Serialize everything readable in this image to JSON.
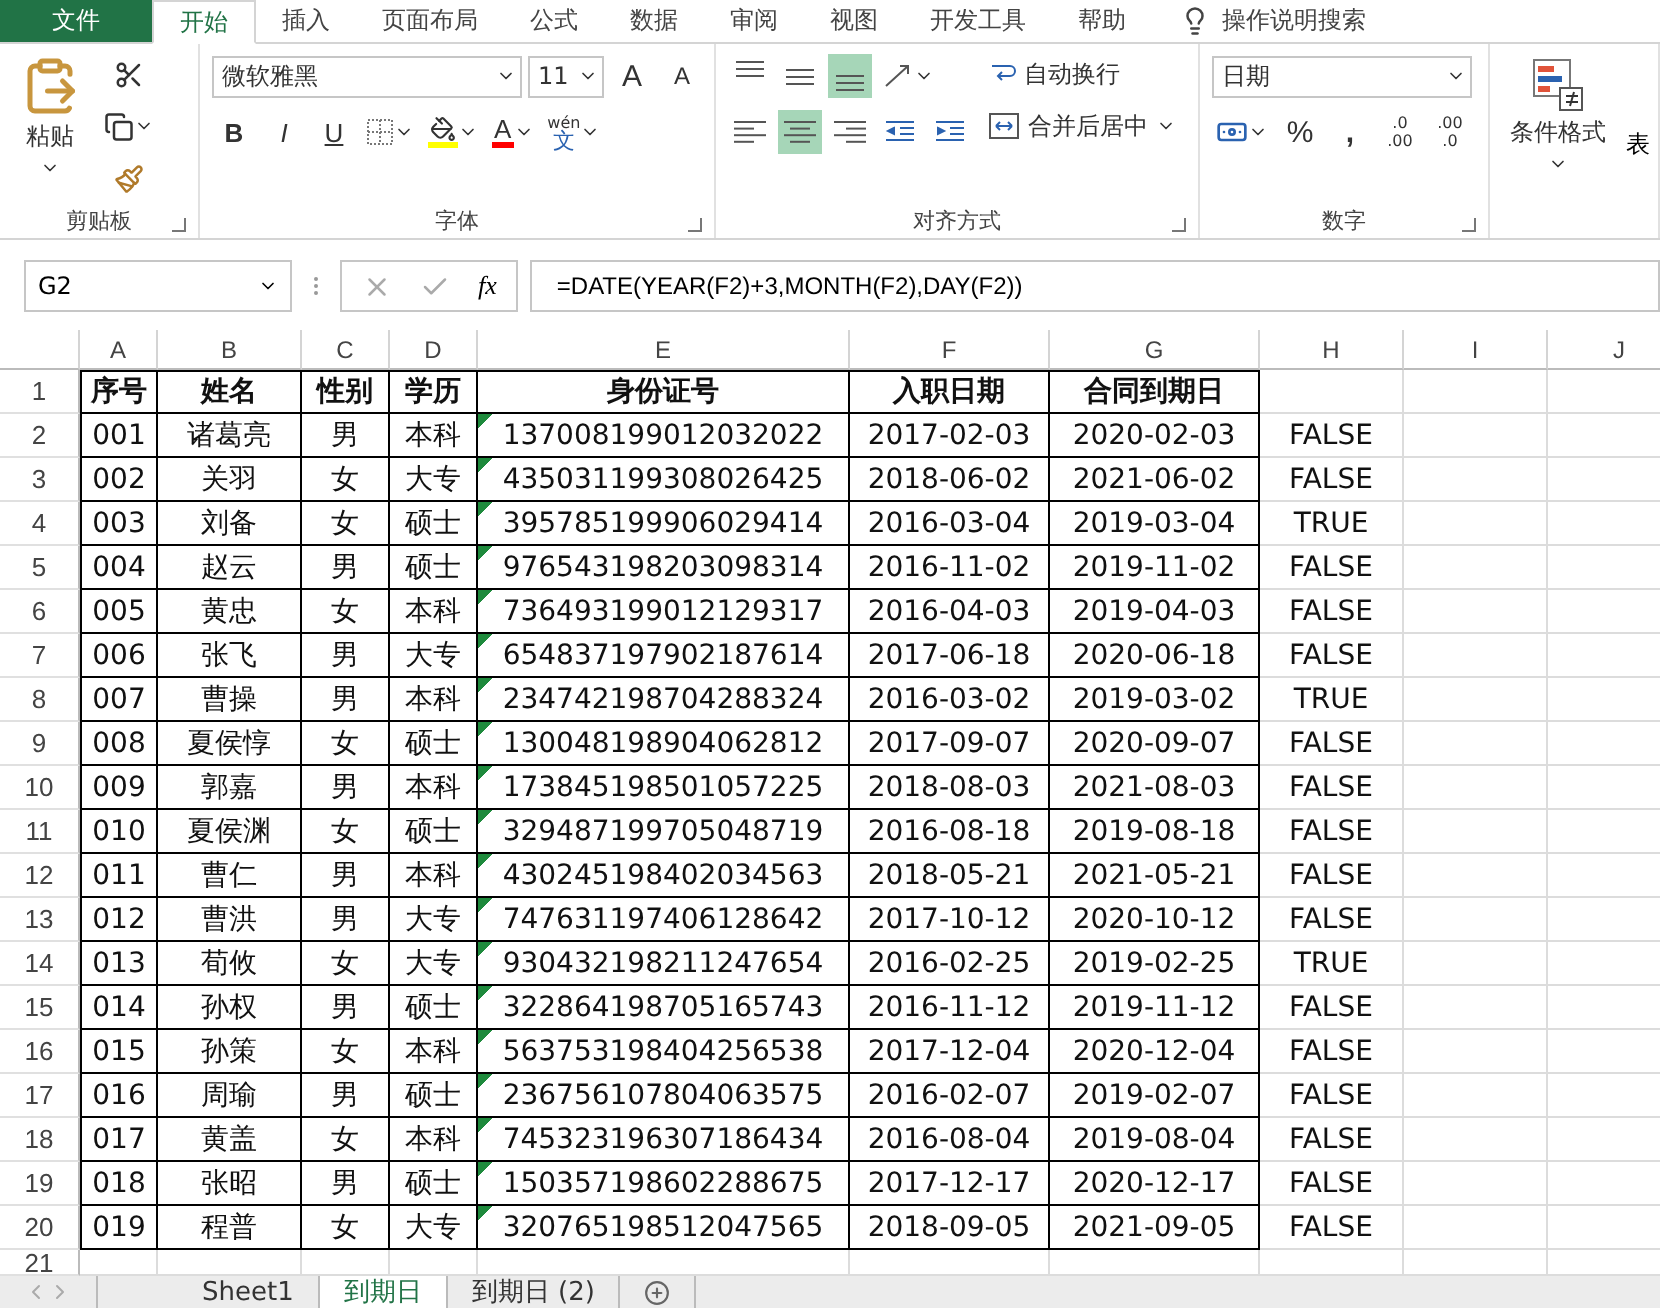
{
  "ribbon_tabs": [
    {
      "label": "文件",
      "kind": "file",
      "selected": false
    },
    {
      "label": "开始",
      "kind": "tab",
      "selected": true
    },
    {
      "label": "插入",
      "kind": "tab",
      "selected": false
    },
    {
      "label": "页面布局",
      "kind": "tab",
      "selected": false
    },
    {
      "label": "公式",
      "kind": "tab",
      "selected": false
    },
    {
      "label": "数据",
      "kind": "tab",
      "selected": false
    },
    {
      "label": "审阅",
      "kind": "tab",
      "selected": false
    },
    {
      "label": "视图",
      "kind": "tab",
      "selected": false
    },
    {
      "label": "开发工具",
      "kind": "tab",
      "selected": false
    },
    {
      "label": "帮助",
      "kind": "tab",
      "selected": false
    }
  ],
  "tell_me": "操作说明搜索",
  "clipboard": {
    "paste": "粘贴",
    "group": "剪贴板"
  },
  "font": {
    "name": "微软雅黑",
    "size": "11",
    "grow": "A",
    "shrink": "A",
    "bold": "B",
    "italic": "I",
    "underline": "U",
    "color_letter": "A",
    "phonetic_top": "wén",
    "phonetic_bottom": "文",
    "group": "字体"
  },
  "alignment": {
    "vertical": [
      {
        "kind": "top",
        "selected": false
      },
      {
        "kind": "middle",
        "selected": false
      },
      {
        "kind": "bottom",
        "selected": true
      }
    ],
    "horizontal": [
      {
        "kind": "left",
        "selected": false
      },
      {
        "kind": "center",
        "selected": true
      },
      {
        "kind": "right",
        "selected": false
      }
    ],
    "wrap": "自动换行",
    "merge": "合并后居中",
    "group": "对齐方式"
  },
  "number": {
    "format": "日期",
    "percent": "%",
    "comma": ",",
    "inc_top": ".0",
    "inc_bottom": ".00",
    "dec_top": ".00",
    "dec_bottom": ".0",
    "group": "数字"
  },
  "styles": {
    "conditional": "条件格式",
    "cut_off": "表"
  },
  "name_box": "G2",
  "fx": "fx",
  "formula": "=DATE(YEAR(F2)+3,MONTH(F2),DAY(F2))",
  "columns": [
    "A",
    "B",
    "C",
    "D",
    "E",
    "F",
    "G",
    "H",
    "I",
    "J"
  ],
  "header_row": [
    "序号",
    "姓名",
    "性别",
    "学历",
    "身份证号",
    "入职日期",
    "合同到期日"
  ],
  "rows": [
    {
      "cells": [
        "001",
        "诸葛亮",
        "男",
        "本科",
        "137008199012032022",
        "2017-02-03",
        "2020-02-03"
      ],
      "h": "FALSE"
    },
    {
      "cells": [
        "002",
        "关羽",
        "女",
        "大专",
        "435031199308026425",
        "2018-06-02",
        "2021-06-02"
      ],
      "h": "FALSE"
    },
    {
      "cells": [
        "003",
        "刘备",
        "女",
        "硕士",
        "395785199906029414",
        "2016-03-04",
        "2019-03-04"
      ],
      "h": "TRUE"
    },
    {
      "cells": [
        "004",
        "赵云",
        "男",
        "硕士",
        "976543198203098314",
        "2016-11-02",
        "2019-11-02"
      ],
      "h": "FALSE"
    },
    {
      "cells": [
        "005",
        "黄忠",
        "女",
        "本科",
        "736493199012129317",
        "2016-04-03",
        "2019-04-03"
      ],
      "h": "FALSE"
    },
    {
      "cells": [
        "006",
        "张飞",
        "男",
        "大专",
        "654837197902187614",
        "2017-06-18",
        "2020-06-18"
      ],
      "h": "FALSE"
    },
    {
      "cells": [
        "007",
        "曹操",
        "男",
        "本科",
        "234742198704288324",
        "2016-03-02",
        "2019-03-02"
      ],
      "h": "TRUE"
    },
    {
      "cells": [
        "008",
        "夏侯惇",
        "女",
        "硕士",
        "130048198904062812",
        "2017-09-07",
        "2020-09-07"
      ],
      "h": "FALSE"
    },
    {
      "cells": [
        "009",
        "郭嘉",
        "男",
        "本科",
        "173845198501057225",
        "2018-08-03",
        "2021-08-03"
      ],
      "h": "FALSE"
    },
    {
      "cells": [
        "010",
        "夏侯渊",
        "女",
        "硕士",
        "329487199705048719",
        "2016-08-18",
        "2019-08-18"
      ],
      "h": "FALSE"
    },
    {
      "cells": [
        "011",
        "曹仁",
        "男",
        "本科",
        "430245198402034563",
        "2018-05-21",
        "2021-05-21"
      ],
      "h": "FALSE"
    },
    {
      "cells": [
        "012",
        "曹洪",
        "男",
        "大专",
        "747631197406128642",
        "2017-10-12",
        "2020-10-12"
      ],
      "h": "FALSE"
    },
    {
      "cells": [
        "013",
        "荀攸",
        "女",
        "大专",
        "930432198211247654",
        "2016-02-25",
        "2019-02-25"
      ],
      "h": "TRUE"
    },
    {
      "cells": [
        "014",
        "孙权",
        "男",
        "硕士",
        "322864198705165743",
        "2016-11-12",
        "2019-11-12"
      ],
      "h": "FALSE"
    },
    {
      "cells": [
        "015",
        "孙策",
        "女",
        "本科",
        "563753198404256538",
        "2017-12-04",
        "2020-12-04"
      ],
      "h": "FALSE"
    },
    {
      "cells": [
        "016",
        "周瑜",
        "男",
        "硕士",
        "236756107804063575",
        "2016-02-07",
        "2019-02-07"
      ],
      "h": "FALSE"
    },
    {
      "cells": [
        "017",
        "黄盖",
        "女",
        "本科",
        "745323196307186434",
        "2016-08-04",
        "2019-08-04"
      ],
      "h": "FALSE"
    },
    {
      "cells": [
        "018",
        "张昭",
        "男",
        "硕士",
        "150357198602288675",
        "2017-12-17",
        "2020-12-17"
      ],
      "h": "FALSE"
    },
    {
      "cells": [
        "019",
        "程普",
        "女",
        "大专",
        "320765198512047565",
        "2018-09-05",
        "2021-09-05"
      ],
      "h": "FALSE"
    }
  ],
  "row_numbers": [
    "1",
    "2",
    "3",
    "4",
    "5",
    "6",
    "7",
    "8",
    "9",
    "10",
    "11",
    "12",
    "13",
    "14",
    "15",
    "16",
    "17",
    "18",
    "19",
    "20",
    "21"
  ],
  "sheet_tabs": [
    {
      "label": "Sheet1",
      "selected": false
    },
    {
      "label": "到期日",
      "selected": true
    },
    {
      "label": "到期日 (2)",
      "selected": false
    }
  ]
}
